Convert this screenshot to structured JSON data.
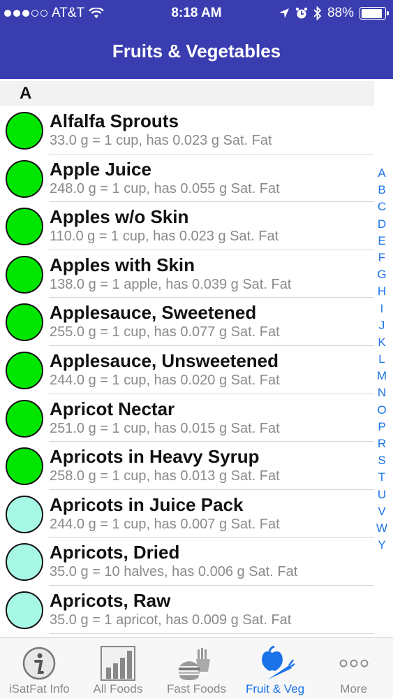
{
  "status_bar": {
    "carrier": "AT&T",
    "time": "8:18 AM",
    "battery": "88%"
  },
  "nav": {
    "title": "Fruits & Vegetables"
  },
  "section": {
    "letter": "A"
  },
  "items": [
    {
      "name": "Alfalfa Sprouts",
      "detail": "33.0 g = 1 cup, has 0.023 g Sat. Fat",
      "color": "#00e600"
    },
    {
      "name": "Apple Juice",
      "detail": "248.0 g = 1 cup, has 0.055 g Sat. Fat",
      "color": "#00e600"
    },
    {
      "name": "Apples w/o Skin",
      "detail": "110.0 g = 1 cup, has 0.023 g Sat. Fat",
      "color": "#00e600"
    },
    {
      "name": "Apples with Skin",
      "detail": "138.0 g = 1 apple, has 0.039 g Sat. Fat",
      "color": "#00e600"
    },
    {
      "name": "Applesauce, Sweetened",
      "detail": "255.0 g = 1 cup, has 0.077 g Sat. Fat",
      "color": "#00e600"
    },
    {
      "name": "Applesauce, Unsweetened",
      "detail": "244.0 g = 1 cup, has 0.020 g Sat. Fat",
      "color": "#00e600"
    },
    {
      "name": "Apricot Nectar",
      "detail": "251.0 g = 1 cup, has 0.015 g Sat. Fat",
      "color": "#00e600"
    },
    {
      "name": "Apricots in Heavy Syrup",
      "detail": "258.0 g = 1 cup, has 0.013 g Sat. Fat",
      "color": "#00e600"
    },
    {
      "name": "Apricots in Juice Pack",
      "detail": "244.0 g = 1 cup, has 0.007 g Sat. Fat",
      "color": "#a6f7e3"
    },
    {
      "name": "Apricots, Dried",
      "detail": "35.0 g = 10 halves, has 0.006 g Sat. Fat",
      "color": "#a6f7e3"
    },
    {
      "name": "Apricots, Raw",
      "detail": "35.0 g = 1 apricot, has 0.009 g Sat. Fat",
      "color": "#a6f7e3"
    }
  ],
  "index_letters": [
    "A",
    "B",
    "C",
    "D",
    "E",
    "F",
    "G",
    "H",
    "I",
    "J",
    "K",
    "L",
    "M",
    "N",
    "O",
    "P",
    "R",
    "S",
    "T",
    "U",
    "V",
    "W",
    "Y"
  ],
  "tabs": [
    {
      "label": "iSatFat Info",
      "icon": "info-icon"
    },
    {
      "label": "All Foods",
      "icon": "bar-chart-icon"
    },
    {
      "label": "Fast Foods",
      "icon": "burger-fries-icon"
    },
    {
      "label": "Fruit & Veg",
      "icon": "apple-carrot-icon",
      "active": true
    },
    {
      "label": "More",
      "icon": "more-icon"
    }
  ]
}
